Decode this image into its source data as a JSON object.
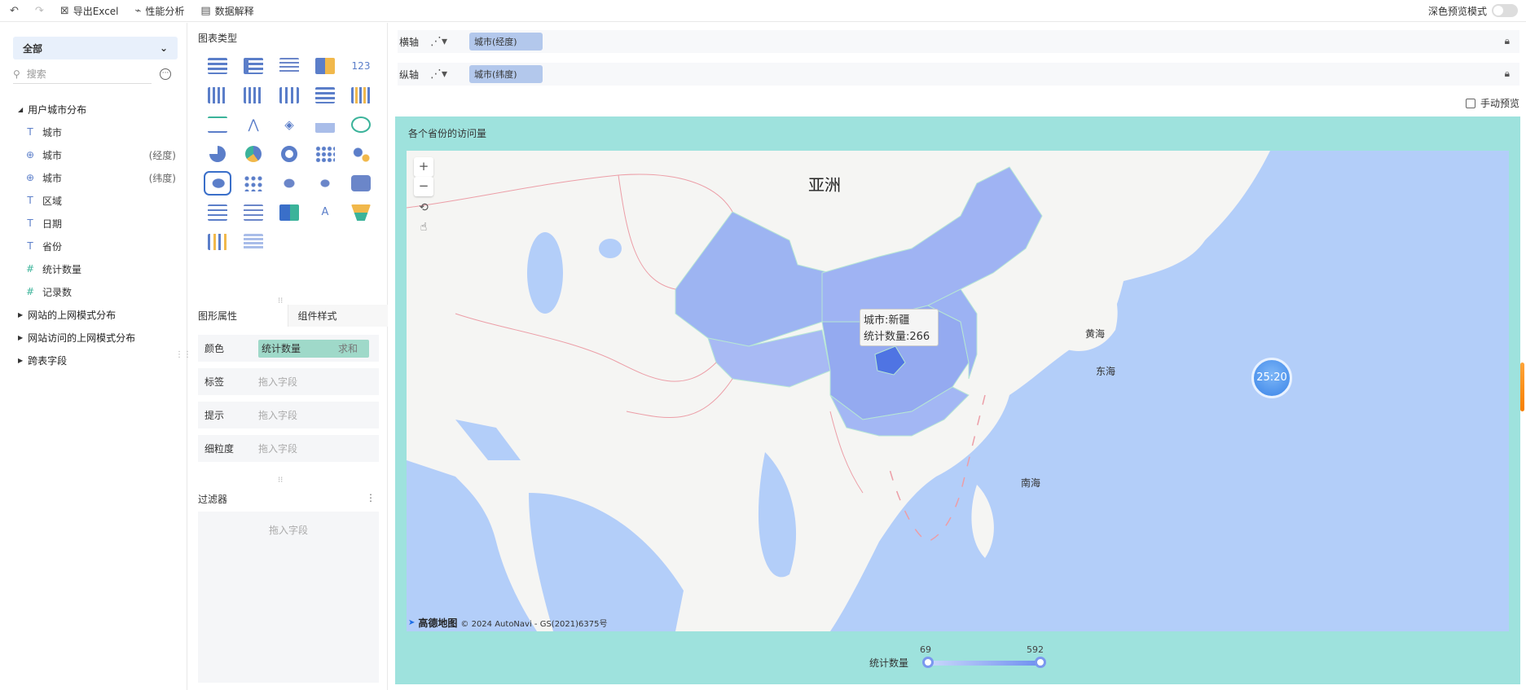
{
  "toolbar": {
    "undo_icon": "undo-icon",
    "redo_icon": "redo-icon",
    "export_label": "导出Excel",
    "perf_label": "性能分析",
    "explain_label": "数据解释",
    "dark_mode_label": "深色预览模式"
  },
  "left": {
    "scope": "全部",
    "search_placeholder": "搜索",
    "groups": [
      {
        "label": "用户城市分布",
        "expanded": true
      },
      {
        "label": "网站的上网模式分布",
        "expanded": false
      },
      {
        "label": "网站访问的上网模式分布",
        "expanded": false
      },
      {
        "label": "跨表字段",
        "expanded": false
      }
    ],
    "fields": [
      {
        "icon": "T",
        "label": "城市",
        "sub": ""
      },
      {
        "icon": "globe",
        "label": "城市",
        "sub": "(经度)"
      },
      {
        "icon": "globe",
        "label": "城市",
        "sub": "(纬度)"
      },
      {
        "icon": "T",
        "label": "区域",
        "sub": ""
      },
      {
        "icon": "T",
        "label": "日期",
        "sub": ""
      },
      {
        "icon": "T",
        "label": "省份",
        "sub": ""
      },
      {
        "icon": "#",
        "label": "统计数量",
        "sub": ""
      },
      {
        "icon": "#",
        "label": "记录数",
        "sub": ""
      }
    ]
  },
  "middle": {
    "chart_types_title": "图表类型",
    "tabs": [
      "图形属性",
      "组件样式"
    ],
    "props": [
      {
        "label": "颜色",
        "value": "统计数量",
        "agg": "求和"
      },
      {
        "label": "标签",
        "hint": "拖入字段"
      },
      {
        "label": "提示",
        "hint": "拖入字段"
      },
      {
        "label": "细粒度",
        "hint": "拖入字段"
      }
    ],
    "filter_title": "过滤器",
    "filter_hint": "拖入字段"
  },
  "axes": {
    "x_label": "横轴",
    "x_field": "城市(经度)",
    "y_label": "纵轴",
    "y_field": "城市(纬度)",
    "manual_preview": "手动预览"
  },
  "chart": {
    "title": "各个省份的访问量",
    "continent_label": "亚洲",
    "sea_labels": [
      "黄海",
      "东海",
      "南海"
    ],
    "tooltip_city": "城市:新疆",
    "tooltip_count": "统计数量:266",
    "timer": "25:20",
    "attribution_logo": "高德地图",
    "attribution_text": "© 2024 AutoNavi - GS(2021)6375号",
    "legend_label": "统计数量",
    "legend_min": "69",
    "legend_max": "592",
    "colors": {
      "background": "#9ee2dd",
      "land": "#f5f5f3",
      "sea": "#b3cef9",
      "region": "#9fb3f3",
      "highlight": "#4f74e3"
    }
  }
}
